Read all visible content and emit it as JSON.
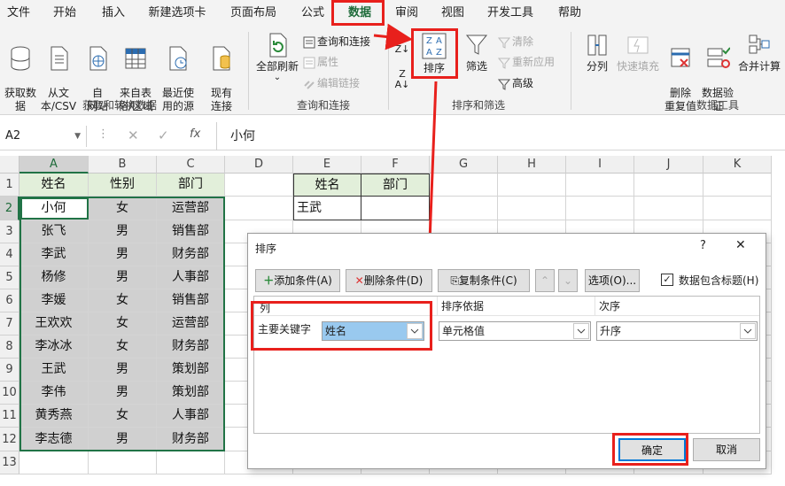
{
  "menu": [
    "文件",
    "开始",
    "插入",
    "新建选项卡",
    "页面布局",
    "公式",
    "数据",
    "审阅",
    "视图",
    "开发工具",
    "帮助"
  ],
  "ribbon": {
    "get": [
      "获取数\n据",
      "从文\n本/CSV",
      "自\n网站",
      "来自表\n格/区域",
      "最近使\n用的源",
      "现有\n连接"
    ],
    "refresh": "全部刷新",
    "query_items": [
      "查询和连接",
      "属性",
      "编辑链接"
    ],
    "sort": "排序",
    "filter": "筛选",
    "filter_items": [
      "清除",
      "重新应用",
      "高级"
    ],
    "tools": [
      "分列",
      "快速填充",
      "删除\n重复值",
      "数据验\n证",
      "合并计算"
    ],
    "groups": [
      "获取和转换数据",
      "查询和连接",
      "排序和筛选",
      "数据工具"
    ]
  },
  "formula": {
    "namebox": "A2",
    "content": "小何"
  },
  "columns": [
    "A",
    "B",
    "C",
    "D",
    "E",
    "F",
    "G",
    "H",
    "I",
    "J",
    "K"
  ],
  "rows": [
    "1",
    "2",
    "3",
    "4",
    "5",
    "6",
    "7",
    "8",
    "9",
    "10",
    "11",
    "12",
    "13"
  ],
  "table": {
    "headers": [
      "姓名",
      "性别",
      "部门"
    ],
    "rows": [
      [
        "小何",
        "女",
        "运营部"
      ],
      [
        "张飞",
        "男",
        "销售部"
      ],
      [
        "李武",
        "男",
        "财务部"
      ],
      [
        "杨修",
        "男",
        "人事部"
      ],
      [
        "李媛",
        "女",
        "销售部"
      ],
      [
        "王欢欢",
        "女",
        "运营部"
      ],
      [
        "李冰冰",
        "女",
        "财务部"
      ],
      [
        "王武",
        "男",
        "策划部"
      ],
      [
        "李伟",
        "男",
        "策划部"
      ],
      [
        "黄秀燕",
        "女",
        "人事部"
      ],
      [
        "李志德",
        "男",
        "财务部"
      ]
    ]
  },
  "lookup": {
    "headers": [
      "姓名",
      "部门"
    ],
    "name": "王武",
    "dept": ""
  },
  "dialog": {
    "title": "排序",
    "help": "?",
    "close": "✕",
    "add": "添加条件(A)",
    "delete": "删除条件(D)",
    "copy": "复制条件(C)",
    "options": "选项(O)...",
    "header_check": "数据包含标题(H)",
    "header_checked": true,
    "col_col": "列",
    "col_basis": "排序依据",
    "col_order": "次序",
    "key_label": "主要关键字",
    "key_value": "姓名",
    "basis_value": "单元格值",
    "order_value": "升序",
    "ok": "确定",
    "cancel": "取消"
  },
  "colors": {
    "green": "#217346",
    "grey_fill": "#d0d0d0",
    "header_fill": "#e2efda",
    "red": "#e8201c",
    "selected": "#99c9ef"
  }
}
